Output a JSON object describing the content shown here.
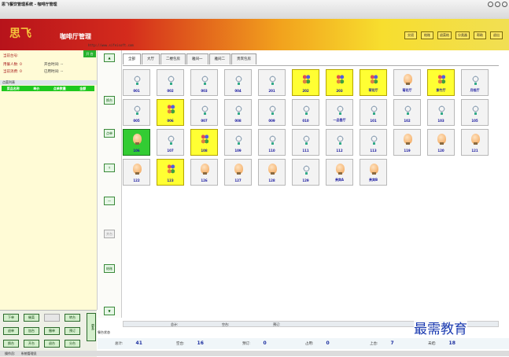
{
  "window": {
    "title": "思飞餐饮管理系统 - 咖啡厅管理"
  },
  "banner": {
    "logo": "思飞",
    "title": "咖啡厅管理",
    "url": "http://www.sifeisoft.com"
  },
  "topbar": {
    "buttons": [
      "交班",
      "结账",
      "退菜结",
      "分类器",
      "帮助",
      "退出"
    ]
  },
  "left": {
    "current_table": "当前台号:",
    "guests": "用餐人数: 0",
    "open_time": "开台时间: --",
    "consume": "当前消费: 0",
    "used_time": "已用时间: --",
    "ok": "开 台",
    "list_header": "点菜列表",
    "columns": [
      "菜品名称",
      "单价",
      "点单数量",
      "金额"
    ]
  },
  "side_buttons": [
    "换台",
    "点单",
    "↑",
    "—",
    "并台",
    "结账"
  ],
  "tabs": [
    "全部",
    "大厅",
    "二楼包房",
    "雅间一",
    "雅间二",
    "贵宾包房"
  ],
  "tables": [
    {
      "label": "001",
      "state": "free",
      "icon": "lamp"
    },
    {
      "label": "002",
      "state": "free",
      "icon": "lamp"
    },
    {
      "label": "003",
      "state": "free",
      "icon": "lamp"
    },
    {
      "label": "004",
      "state": "free",
      "icon": "lamp"
    },
    {
      "label": "201",
      "state": "free",
      "icon": "lamp"
    },
    {
      "label": "202",
      "state": "busy",
      "icon": "people"
    },
    {
      "label": "203",
      "state": "busy",
      "icon": "people"
    },
    {
      "label": "荷花厅",
      "state": "busy",
      "icon": "people"
    },
    {
      "label": "菊花厅",
      "state": "free",
      "icon": "cup"
    },
    {
      "label": "紫竹厅",
      "state": "busy",
      "icon": "people"
    },
    {
      "label": "月桂厅",
      "state": "free",
      "icon": "lamp"
    },
    {
      "label": "005",
      "state": "free",
      "icon": "lamp"
    },
    {
      "label": "006",
      "state": "busy",
      "icon": "people"
    },
    {
      "label": "007",
      "state": "free",
      "icon": "lamp"
    },
    {
      "label": "008",
      "state": "free",
      "icon": "lamp"
    },
    {
      "label": "009",
      "state": "free",
      "icon": "lamp"
    },
    {
      "label": "010",
      "state": "free",
      "icon": "lamp"
    },
    {
      "label": "一品香厅",
      "state": "free",
      "icon": "lamp"
    },
    {
      "label": "101",
      "state": "free",
      "icon": "lamp"
    },
    {
      "label": "102",
      "state": "free",
      "icon": "lamp"
    },
    {
      "label": "103",
      "state": "free",
      "icon": "lamp"
    },
    {
      "label": "105",
      "state": "free",
      "icon": "lamp"
    },
    {
      "label": "106",
      "state": "selected",
      "icon": "cup"
    },
    {
      "label": "107",
      "state": "free",
      "icon": "lamp"
    },
    {
      "label": "108",
      "state": "busy",
      "icon": "people"
    },
    {
      "label": "109",
      "state": "free",
      "icon": "lamp"
    },
    {
      "label": "110",
      "state": "free",
      "icon": "lamp"
    },
    {
      "label": "111",
      "state": "free",
      "icon": "lamp"
    },
    {
      "label": "112",
      "state": "free",
      "icon": "lamp"
    },
    {
      "label": "113",
      "state": "free",
      "icon": "lamp"
    },
    {
      "label": "119",
      "state": "free",
      "icon": "cup"
    },
    {
      "label": "120",
      "state": "free",
      "icon": "cup"
    },
    {
      "label": "121",
      "state": "free",
      "icon": "cup"
    },
    {
      "label": "122",
      "state": "free",
      "icon": "cup"
    },
    {
      "label": "123",
      "state": "busy",
      "icon": "people"
    },
    {
      "label": "126",
      "state": "free",
      "icon": "cup"
    },
    {
      "label": "127",
      "state": "free",
      "icon": "cup"
    },
    {
      "label": "128",
      "state": "free",
      "icon": "cup"
    },
    {
      "label": "129",
      "state": "free",
      "icon": "lamp"
    },
    {
      "label": "贵宾A",
      "state": "free",
      "icon": "cup"
    },
    {
      "label": "贵宾B",
      "state": "free",
      "icon": "cup"
    }
  ],
  "bottom_buttons": [
    "下单",
    "催菜",
    "",
    "转台",
    "退单",
    "加台",
    "撤单",
    "预订",
    "换台",
    "开台",
    "退台",
    "分台"
  ],
  "more": "更多",
  "statusbar": {
    "a": "总计:",
    "b": "空台:",
    "c": "预订:"
  },
  "legend": "餐台状态",
  "counts": [
    {
      "label": "总计:",
      "value": "41"
    },
    {
      "label": "空台:",
      "value": "16"
    },
    {
      "label": "预订:",
      "value": "0"
    },
    {
      "label": "占用:",
      "value": "0"
    },
    {
      "label": "上台:",
      "value": "7"
    },
    {
      "label": "未结:",
      "value": "18"
    }
  ],
  "footer": {
    "user": "操作员:",
    "name": "系统管理员"
  },
  "watermark": "最需教育"
}
